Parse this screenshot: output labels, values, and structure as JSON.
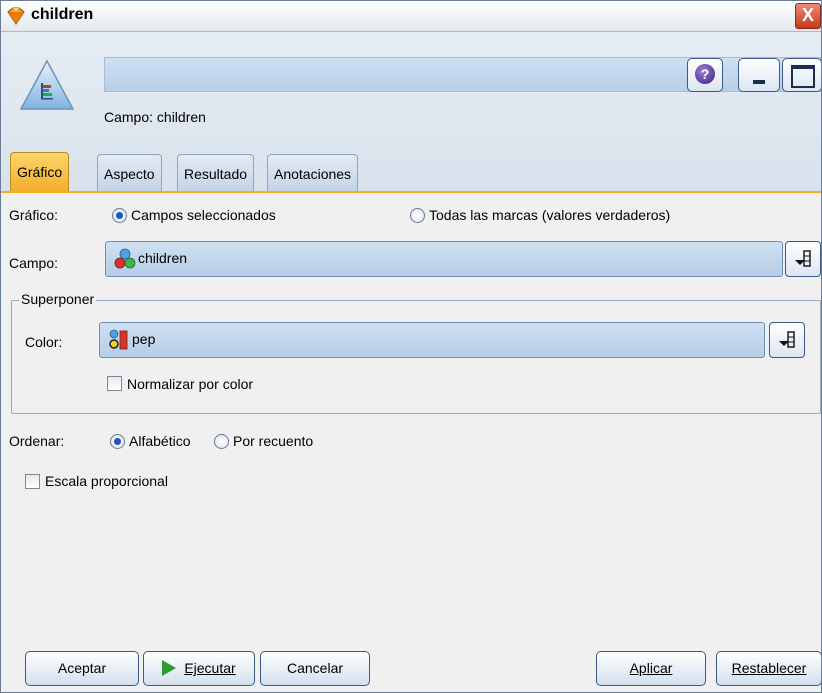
{
  "window": {
    "title": "children",
    "close_label": "X"
  },
  "header": {
    "campo_label": "Campo: children",
    "help_label": "?"
  },
  "tabs": [
    {
      "label": "Gráfico",
      "active": true
    },
    {
      "label": "Aspecto",
      "active": false
    },
    {
      "label": "Resultado",
      "active": false
    },
    {
      "label": "Anotaciones",
      "active": false
    }
  ],
  "grafico": {
    "label": "Gráfico:",
    "option_selected": "Campos seleccionados",
    "option_other": "Todas las marcas (valores verdaderos)"
  },
  "campo": {
    "label": "Campo:",
    "value": "children",
    "icon": "set-field-icon"
  },
  "superponer": {
    "title": "Superponer",
    "color_label": "Color:",
    "color_value": "pep",
    "color_icon": "flag-field-icon",
    "normalize_label": "Normalizar por color",
    "normalize_checked": false
  },
  "ordenar": {
    "label": "Ordenar:",
    "option_alpha": "Alfabético",
    "option_count": "Por recuento",
    "selected": "Alfabético"
  },
  "scale": {
    "label": "Escala proporcional",
    "checked": false
  },
  "buttons": {
    "ok": "Aceptar",
    "run": "Ejecutar",
    "cancel": "Cancelar",
    "apply": "Aplicar",
    "reset": "Restablecer"
  },
  "colors": {
    "accent_tab": "#f3ad29",
    "header_bg": "#d9e2ec",
    "combo_bg": "#b6cde6",
    "close": "#c4391c"
  }
}
